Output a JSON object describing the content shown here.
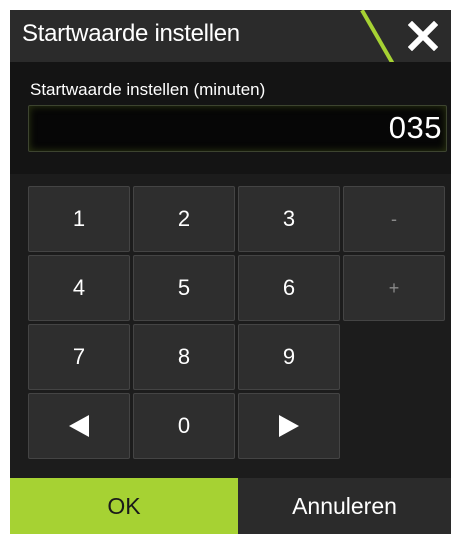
{
  "dialog": {
    "title": "Startwaarde instellen",
    "close_icon": "close-icon",
    "accent_color": "#a6d233"
  },
  "input": {
    "label": "Startwaarde instellen (minuten)",
    "value": "035"
  },
  "keypad": {
    "keys": {
      "k1": "1",
      "k2": "2",
      "k3": "3",
      "minus": "-",
      "k4": "4",
      "k5": "5",
      "k6": "6",
      "plus": "+",
      "k7": "7",
      "k8": "8",
      "k9": "9",
      "k0": "0"
    },
    "left_icon": "arrow-left-icon",
    "right_icon": "arrow-right-icon"
  },
  "footer": {
    "ok_label": "OK",
    "cancel_label": "Annuleren"
  }
}
